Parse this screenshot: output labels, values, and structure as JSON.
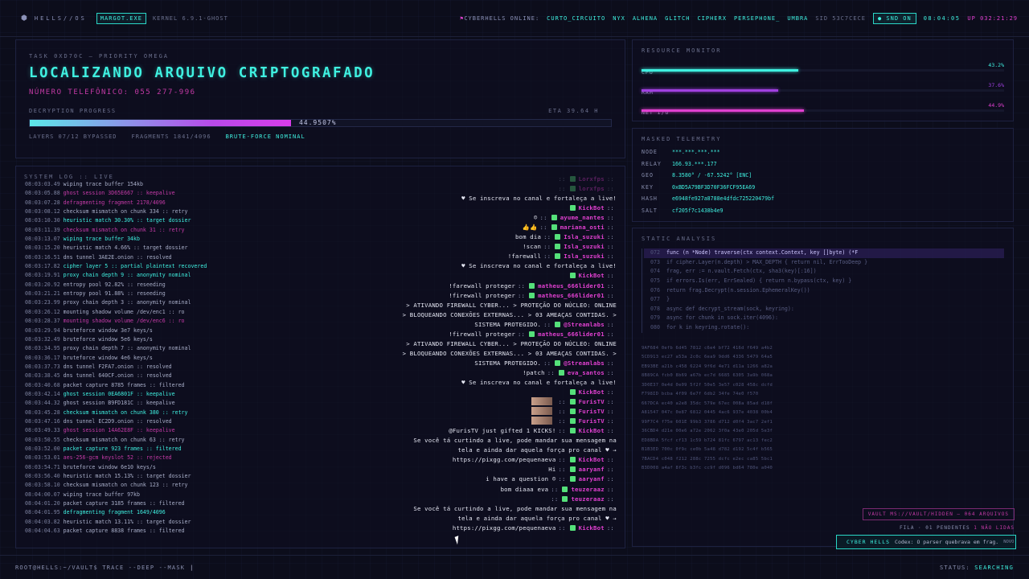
{
  "topbar": {
    "icon": "hex-icon",
    "brand": "HELLS//OS",
    "user_pill": "MARGOT.EXE",
    "kernel": "KERNEL 6.9.1-GHOST",
    "online_label": "CYBERHELLS ONLINE:",
    "online_users": [
      "CURTO_CIRCUITO",
      "NYX",
      "ALHENA",
      "GLITCH",
      "CIPHERX",
      "PERSEPHONE_",
      "UMBRA"
    ],
    "sid": "SID 53C7CECE",
    "snd": "SND ON",
    "clock": "08:04:05",
    "uptime": "UP 032:21:29"
  },
  "task": {
    "tag": "TASK 0XD70C — PRIORITY OMEGA",
    "title": "LOCALIZANDO ARQUIVO CRIPTOGRAFADO",
    "phone": "NÚMERO TELEFÔNICO: 055 277-996",
    "progress_label": "DECRYPTION PROGRESS",
    "eta": "ETA 39.64 H",
    "progress": 44.9507,
    "progress_text": "44.9507%",
    "layers": "LAYERS 07/12 BYPASSED",
    "fragments": "FRAGMENTS 1841/4096",
    "bruteforce": "BRUTE-FORCE NOMINAL"
  },
  "syslog": {
    "title": "SYSTEM LOG :: LIVE",
    "lines": [
      {
        "t": "08:03:03.49",
        "m": "wiping trace buffer 154kb",
        "c": ""
      },
      {
        "t": "08:03:05.88",
        "m": "ghost session 3D65E667 :: keepalive",
        "c": "pink"
      },
      {
        "t": "08:03:07.28",
        "m": "defragmenting fragment 2178/4096",
        "c": "pink"
      },
      {
        "t": "08:03:08.12",
        "m": "checksum mismatch on chunk 334 :: retry",
        "c": ""
      },
      {
        "t": "08:03:10.30",
        "m": "heuristic match 30.30% :: target dossier",
        "c": "cyan"
      },
      {
        "t": "08:03:11.39",
        "m": "checksum mismatch on chunk 31 :: retry",
        "c": "pink"
      },
      {
        "t": "08:03:13.07",
        "m": "wiping trace buffer 34kb",
        "c": "cyan"
      },
      {
        "t": "08:03:15.20",
        "m": "heuristic match 4.66% :: target dossier",
        "c": ""
      },
      {
        "t": "08:03:16.51",
        "m": "dns tunnel 3AE2E.onion :: resolved",
        "c": ""
      },
      {
        "t": "08:03:17.82",
        "m": "cipher layer 5 :: partial plaintext recovered",
        "c": "cyan"
      },
      {
        "t": "08:03:19.91",
        "m": "proxy chain depth 9 :: anonymity nominal",
        "c": "cyan"
      },
      {
        "t": "08:03:20.92",
        "m": "entropy pool 92.82% :: reseeding",
        "c": ""
      },
      {
        "t": "08:03:21.21",
        "m": "entropy pool 91.88% :: reseeding",
        "c": ""
      },
      {
        "t": "08:03:23.99",
        "m": "proxy chain depth 3 :: anonymity nominal",
        "c": ""
      },
      {
        "t": "08:03:26.12",
        "m": "mounting shadow volume /dev/enc1 :: ro",
        "c": ""
      },
      {
        "t": "08:03:28.37",
        "m": "mounting shadow volume /dev/enc6 :: ro",
        "c": "pink"
      },
      {
        "t": "08:03:29.94",
        "m": "bruteforce window 3e7 keys/s",
        "c": ""
      },
      {
        "t": "08:03:32.49",
        "m": "bruteforce window 5e6 keys/s",
        "c": ""
      },
      {
        "t": "08:03:34.95",
        "m": "proxy chain depth 7 :: anonymity nominal",
        "c": ""
      },
      {
        "t": "08:03:36.17",
        "m": "bruteforce window 4e6 keys/s",
        "c": ""
      },
      {
        "t": "08:03:37.73",
        "m": "dns tunnel F2FA7.onion :: resolved",
        "c": ""
      },
      {
        "t": "08:03:38.45",
        "m": "dns tunnel 640CF.onion :: resolved",
        "c": ""
      },
      {
        "t": "08:03:40.68",
        "m": "packet capture 8785 frames :: filtered",
        "c": ""
      },
      {
        "t": "08:03:42.14",
        "m": "ghost session 0EA6801F :: keepalive",
        "c": "cyan"
      },
      {
        "t": "08:03:44.32",
        "m": "ghost session B9FD181C :: keepalive",
        "c": ""
      },
      {
        "t": "08:03:45.28",
        "m": "checksum mismatch on chunk 380 :: retry",
        "c": "cyan"
      },
      {
        "t": "08:03:47.16",
        "m": "dns tunnel EC2D9.onion :: resolved",
        "c": ""
      },
      {
        "t": "08:03:49.33",
        "m": "ghost session 14A62E8F :: keepalive",
        "c": "pink"
      },
      {
        "t": "08:03:50.55",
        "m": "checksum mismatch on chunk 63 :: retry",
        "c": ""
      },
      {
        "t": "08:03:52.00",
        "m": "packet capture 923 frames :: filtered",
        "c": "cyan"
      },
      {
        "t": "08:03:53.01",
        "m": "aes-256-gcm keyslot 52 :: rejected",
        "c": "pink"
      },
      {
        "t": "08:03:54.71",
        "m": "bruteforce window 6e10 keys/s",
        "c": ""
      },
      {
        "t": "08:03:56.40",
        "m": "heuristic match 15.13% :: target dossier",
        "c": ""
      },
      {
        "t": "08:03:58.10",
        "m": "checksum mismatch on chunk 123 :: retry",
        "c": ""
      },
      {
        "t": "08:04:00.07",
        "m": "wiping trace buffer 97kb",
        "c": ""
      },
      {
        "t": "08:04:01.20",
        "m": "packet capture 3185 frames :: filtered",
        "c": ""
      },
      {
        "t": "08:04:01.95",
        "m": "defragmenting fragment 1649/4096",
        "c": "cyan"
      },
      {
        "t": "08:04:03.82",
        "m": "heuristic match 13.11% :: target dossier",
        "c": ""
      },
      {
        "t": "08:04:04.63",
        "m": "packet capture 8838 frames :: filtered",
        "c": ""
      }
    ]
  },
  "chat": {
    "lines": [
      {
        "type": "user",
        "msg": "",
        "user": "Lorxfps",
        "faint": true
      },
      {
        "type": "user",
        "msg": "",
        "user": "lorxfps",
        "faint": true
      },
      {
        "type": "bot",
        "msg": "♥ Se inscreva no canal e fortaleça a live!"
      },
      {
        "type": "name",
        "user": "KickBot"
      },
      {
        "type": "user",
        "msg": "☺",
        "user": "ayume_nantes"
      },
      {
        "type": "user",
        "msg": "👍👍",
        "user": "mariana_osti"
      },
      {
        "type": "user",
        "msg": "bom dia",
        "user": "Isla_suzuki"
      },
      {
        "type": "user",
        "msg": "!scan",
        "user": "Isla_suzuki"
      },
      {
        "type": "user",
        "msg": "!farewall",
        "user": "Isla_suzuki"
      },
      {
        "type": "bot",
        "msg": "♥ Se inscreva no canal e fortaleça a live!"
      },
      {
        "type": "name",
        "user": "KickBot"
      },
      {
        "type": "user",
        "msg": "!farewall proteger",
        "user": "matheus_666lider01"
      },
      {
        "type": "user",
        "msg": "!firewall proteger",
        "user": "matheus_666lider01"
      },
      {
        "type": "sys",
        "msg": "> ATIVANDO FIREWALL CYBER... > PROTEÇÃO DO NÚCLEO: ONLINE"
      },
      {
        "type": "sys",
        "msg": "> BLOQUEANDO CONEXÕES EXTERNAS... > 03 AMEAÇAS CONTIDAS. >"
      },
      {
        "type": "user",
        "msg": "SISTEMA PROTEGIDO.",
        "user": "@Streamlabs"
      },
      {
        "type": "user",
        "msg": "!firewall proteger",
        "user": "matheus_666lider01"
      },
      {
        "type": "sys",
        "msg": "> ATIVANDO FIREWALL CYBER... > PROTEÇÃO DO NÚCLEO: ONLINE"
      },
      {
        "type": "sys",
        "msg": "> BLOQUEANDO CONEXÕES EXTERNAS... > 03 AMEAÇAS CONTIDAS. >"
      },
      {
        "type": "user",
        "msg": "SISTEMA PROTEGIDO.",
        "user": "@Streamlabs"
      },
      {
        "type": "user",
        "msg": "!patch",
        "user": "eva_santos"
      },
      {
        "type": "bot",
        "msg": "♥ Se inscreva no canal e fortaleça a live!"
      },
      {
        "type": "name",
        "user": "KickBot"
      },
      {
        "type": "avatar",
        "user": "FurisTV"
      },
      {
        "type": "avatar",
        "user": "FurisTV"
      },
      {
        "type": "avatar",
        "user": "FurisTV"
      },
      {
        "type": "user",
        "msg": "@FurisTV just gifted 1 KICKS!",
        "user": "KickBot"
      },
      {
        "type": "sys",
        "msg": "Se você tá curtindo a live, pode mandar sua mensagem na"
      },
      {
        "type": "sys",
        "msg": "tela e ainda dar aquela força pro canal ♥ →"
      },
      {
        "type": "user",
        "msg": "https://pixgg.com/pequenaeva",
        "user": "KickBot"
      },
      {
        "type": "user",
        "msg": "Hi",
        "user": "aaryanf"
      },
      {
        "type": "user",
        "msg": "i have a question ☺",
        "user": "aaryanf"
      },
      {
        "type": "user",
        "msg": "bom diaaa eva",
        "user": "teuzeraaz"
      },
      {
        "type": "user",
        "msg": "",
        "user": "teuzeraaz"
      },
      {
        "type": "sys",
        "msg": "Se você tá curtindo a live, pode mandar sua mensagem na"
      },
      {
        "type": "sys",
        "msg": "tela e ainda dar aquela força pro canal ♥ →"
      },
      {
        "type": "user",
        "msg": "https://pixgg.com/pequenaeva",
        "user": "KickBot"
      }
    ]
  },
  "resources": {
    "title": "RESOURCE MONITOR",
    "items": [
      {
        "label": "CPU",
        "value": "43.2%",
        "pct": 43.2,
        "color": "#3ff0e0"
      },
      {
        "label": "RAM",
        "value": "37.6%",
        "pct": 37.6,
        "color": "#a040e0"
      },
      {
        "label": "NET I/O",
        "value": "44.9%",
        "pct": 44.9,
        "color": "#e040d0"
      }
    ]
  },
  "telemetry": {
    "title": "MASKED TELEMETRY",
    "rows": [
      {
        "k": "NODE",
        "v": "***.***.***.***"
      },
      {
        "k": "RELAY",
        "v": "166.93.***.177"
      },
      {
        "k": "GEO",
        "v": "8.3580° / -67.5242° [ENC]"
      },
      {
        "k": "KEY",
        "v": "0xBD5A79BF3D70F36FCF95EA69"
      },
      {
        "k": "HASH",
        "v": "e6948fe927a8788e4dfdc725220479bf"
      },
      {
        "k": "SALT",
        "v": "cf205f7c1438b4e9"
      }
    ]
  },
  "static": {
    "title": "STATIC ANALYSIS",
    "code": [
      {
        "n": "072",
        "c": "func (n *Node) traverse(ctx context.Context, key []byte) (*F",
        "hl": true
      },
      {
        "n": "073",
        "c": "if cipher.Layer(n.depth) > MAX_DEPTH { return nil, ErrTooDeep }",
        "hl": false
      },
      {
        "n": "074",
        "c": "frag, err := n.vault.Fetch(ctx, sha3(key)[:16])",
        "hl": false
      },
      {
        "n": "075",
        "c": "if errors.Is(err, ErrSealed) { return n.bypass(ctx, key) }",
        "hl": false
      },
      {
        "n": "076",
        "c": "return frag.Decrypt(n.session.EphemeralKey())",
        "hl": false
      },
      {
        "n": "077",
        "c": "}",
        "hl": false
      },
      {
        "n": "078",
        "c": "async def decrypt_stream(sock, keyring):",
        "hl": false
      },
      {
        "n": "079",
        "c": "async for chunk in sock.iter(4096):",
        "hl": false
      },
      {
        "n": "080",
        "c": "for k in keyring.rotate():",
        "hl": false
      }
    ],
    "hex": [
      "9AF684 0efb 6d45 7812 c6e4 bf72 416d f649 a4b2",
      "5CD913 ec27 a53a 2c0c 6ea9 9dd6 4336 5479 64a5",
      "EB93BE a21b c458 6224 9f6d 4e71 d11a 1266 a82a",
      "8B89CA fcb0 8b69 a67b ec7d 6685 6305 3a9b 068a",
      "3D0E37 0e4d 0e09 5f2f 50e5 3e57 c028 458c dcfd",
      "F798ID bcba 4f09 6e7f 6db2 34fe 74e0 f570",
      "667DCA ec40 a2e8 35dc 579e 67ec 008a 85ad d18f",
      "A81547 047c 0e87 6812 0445 4ac6 937e 4038 00b4",
      "99F7C4 f75e 601E 99b3 3786 d712 d0f4 3ac7 2ef1",
      "36CBD4 d21e 00e6 a72e 2062 3f0a 43e0 205d 5e3f",
      "ED8BDA 5fcf cf13 1c59 b724 81fc 6797 ac13 fec2",
      "B1B3ED 700c 0f9c ce0b 5a48 d782 d192 5c4f b565",
      "7BACD4 c048 f212 288c 7255 dcfc e2ec ca85 5bc1",
      "B3D008 a4af 8f3c b3fc cc9f d096 bd64 780e a040"
    ],
    "vault": "VAULT MS://VAULT/HIDDEN — 064 ARQUIVOS",
    "fila_label": "FILA · 01 PENDENTES",
    "fila_status": "1 NÃO LIDAS"
  },
  "toast": {
    "title": "CYBER HELLS",
    "msg": "Codex: O parser quebrava em frag.",
    "tag": "NOVO"
  },
  "bottombar": {
    "cmd": "ROOT@HELLS:~/VAULT$ TRACE --DEEP --MASK",
    "cursor": "|",
    "status_label": "STATUS:",
    "status_value": "SEARCHING"
  }
}
